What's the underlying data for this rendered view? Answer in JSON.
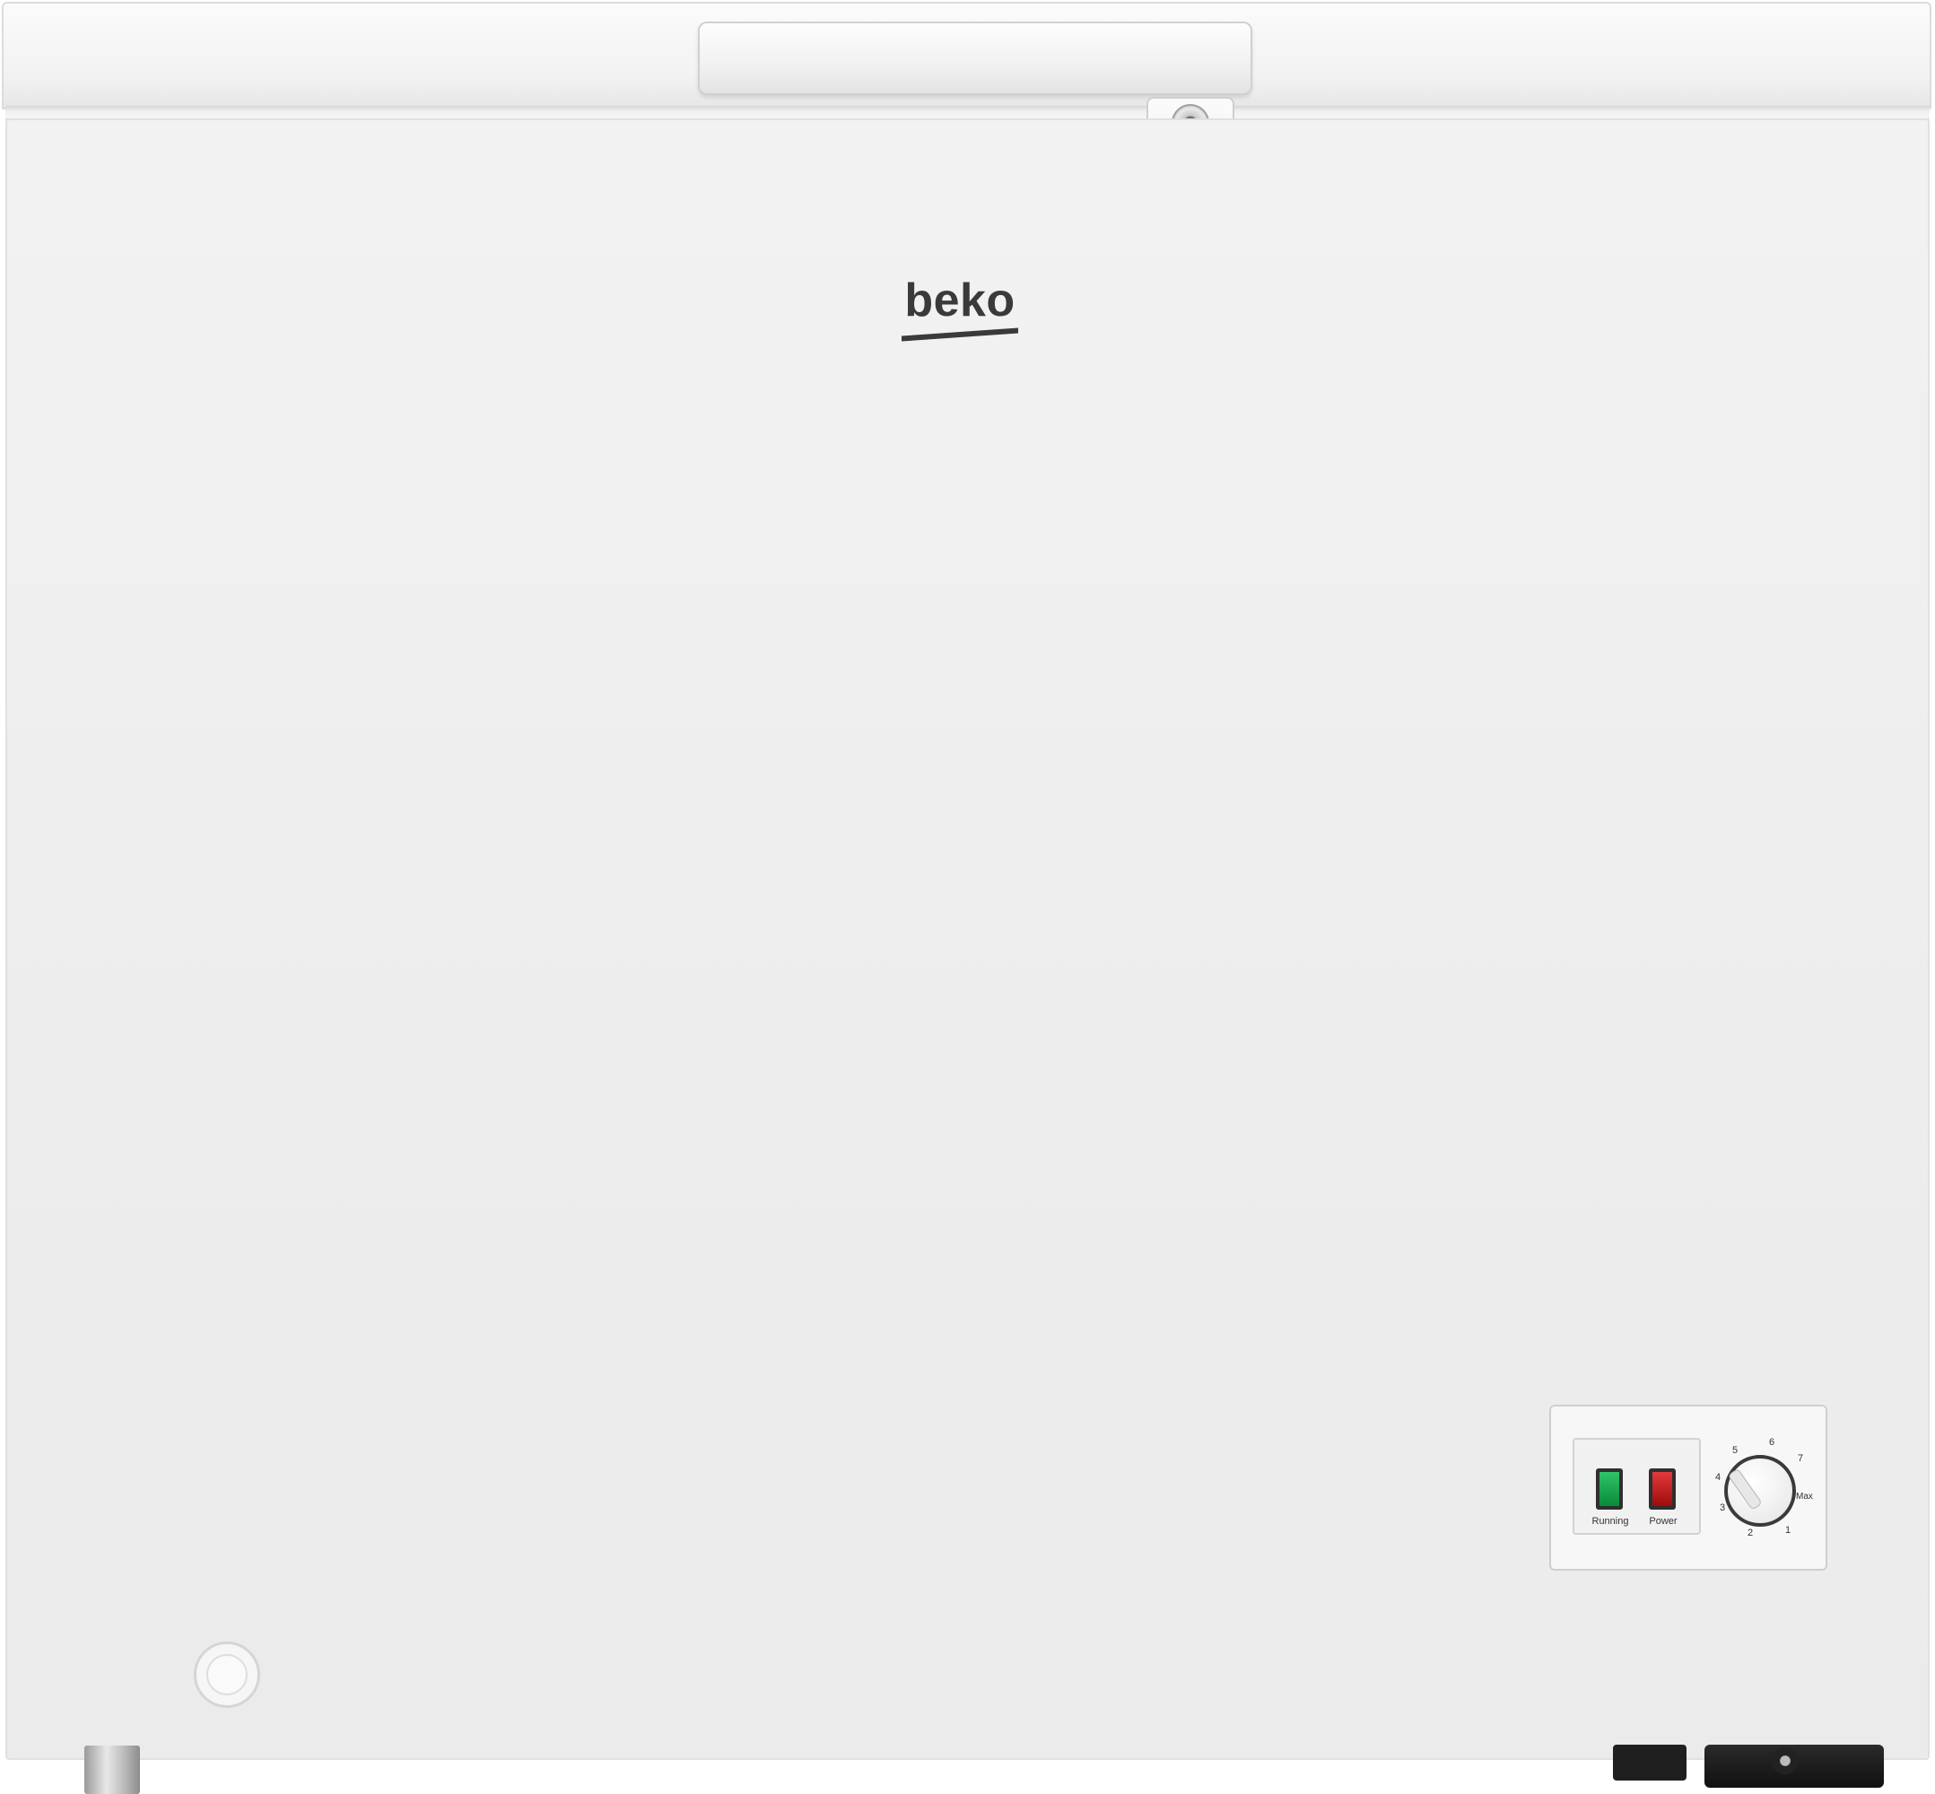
{
  "product": {
    "brand_logo": "beko"
  },
  "control_panel": {
    "indicators": [
      {
        "label": "Running",
        "color": "#1aa352"
      },
      {
        "label": "Power",
        "color": "#c81d1d"
      }
    ],
    "thermostat": {
      "scale": [
        "1",
        "2",
        "3",
        "4",
        "5",
        "6",
        "7"
      ],
      "max_label": "Max"
    }
  },
  "colors": {
    "body": "#eeeeee",
    "logo": "#3a3a3a"
  },
  "icons": [
    "lock-icon",
    "drain-plug-icon",
    "thermostat-dial-icon"
  ]
}
